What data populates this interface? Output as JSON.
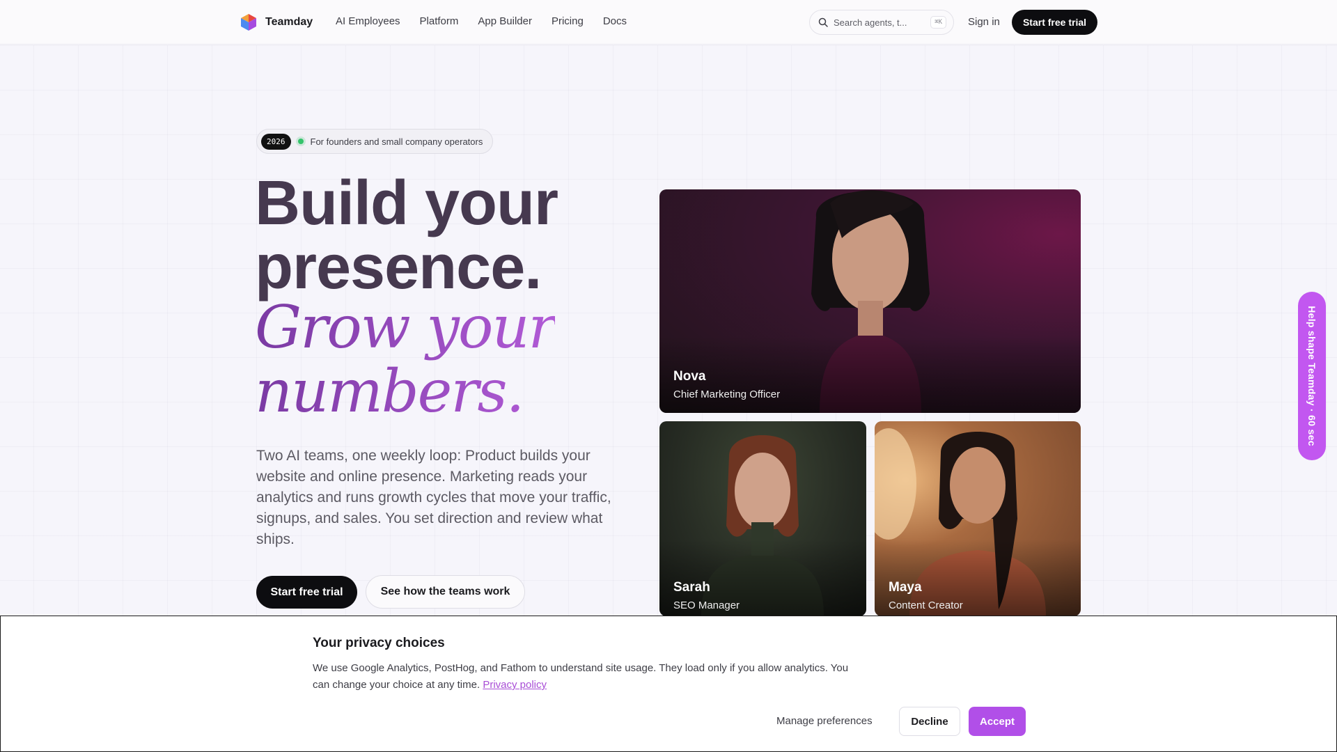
{
  "header": {
    "brand": "Teamday",
    "nav": [
      "AI Employees",
      "Platform",
      "App Builder",
      "Pricing",
      "Docs"
    ],
    "search_placeholder": "Search agents, t...",
    "search_shortcut": "⌘K",
    "signin_label": "Sign in",
    "cta_label": "Start free trial"
  },
  "hero": {
    "badge_year": "2026",
    "badge_text": "For founders and small company operators",
    "headline_line1": "Build your",
    "headline_line2": "presence.",
    "serif_line1": "Grow your",
    "serif_line2": "numbers.",
    "lede": "Two AI teams, one weekly loop: Product builds your website and online presence. Marketing reads your analytics and runs growth cycles that move your traffic, signups, and sales. You set direction and review what ships.",
    "cta_primary": "Start free trial",
    "cta_secondary": "See how the teams work"
  },
  "team": [
    {
      "name": "Nova",
      "role": "Chief Marketing Officer"
    },
    {
      "name": "Sarah",
      "role": "SEO Manager"
    },
    {
      "name": "Maya",
      "role": "Content Creator"
    }
  ],
  "side_tab": "Help shape Teamday · 60 sec",
  "cookie": {
    "title": "Your privacy choices",
    "body": "We use Google Analytics, PostHog, and Fathom to understand site usage. They load only if you allow analytics. You can change your choice at any time.",
    "link": "Privacy policy",
    "manage": "Manage preferences",
    "decline": "Decline",
    "accept": "Accept"
  },
  "colors": {
    "accent": "#b14fe8",
    "headline": "#46394f",
    "side_tab": "#c257f0"
  }
}
